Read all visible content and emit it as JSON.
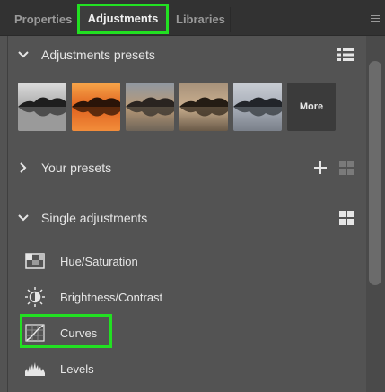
{
  "tabs": [
    {
      "label": "Properties",
      "active": false
    },
    {
      "label": "Adjustments",
      "active": true
    },
    {
      "label": "Libraries",
      "active": false
    }
  ],
  "highlight_color": "#22e022",
  "sections": {
    "presets": {
      "title": "Adjustments presets",
      "expanded": true
    },
    "your_presets": {
      "title": "Your presets",
      "expanded": false
    },
    "single": {
      "title": "Single adjustments",
      "expanded": true
    }
  },
  "preset_thumbnails": [
    {
      "name": "preset-bw",
      "sky": "#bdbdbd"
    },
    {
      "name": "preset-orange",
      "sky": "#e8792c"
    },
    {
      "name": "preset-warm",
      "sky": "#9a8a74"
    },
    {
      "name": "preset-sepia",
      "sky": "#8e7a62"
    },
    {
      "name": "preset-cool",
      "sky": "#9aa2ad"
    }
  ],
  "more_label": "More",
  "adjustments": [
    {
      "label": "Hue/Saturation",
      "icon": "hue-saturation-icon"
    },
    {
      "label": "Brightness/Contrast",
      "icon": "brightness-contrast-icon"
    },
    {
      "label": "Curves",
      "icon": "curves-icon"
    },
    {
      "label": "Levels",
      "icon": "levels-icon"
    }
  ]
}
